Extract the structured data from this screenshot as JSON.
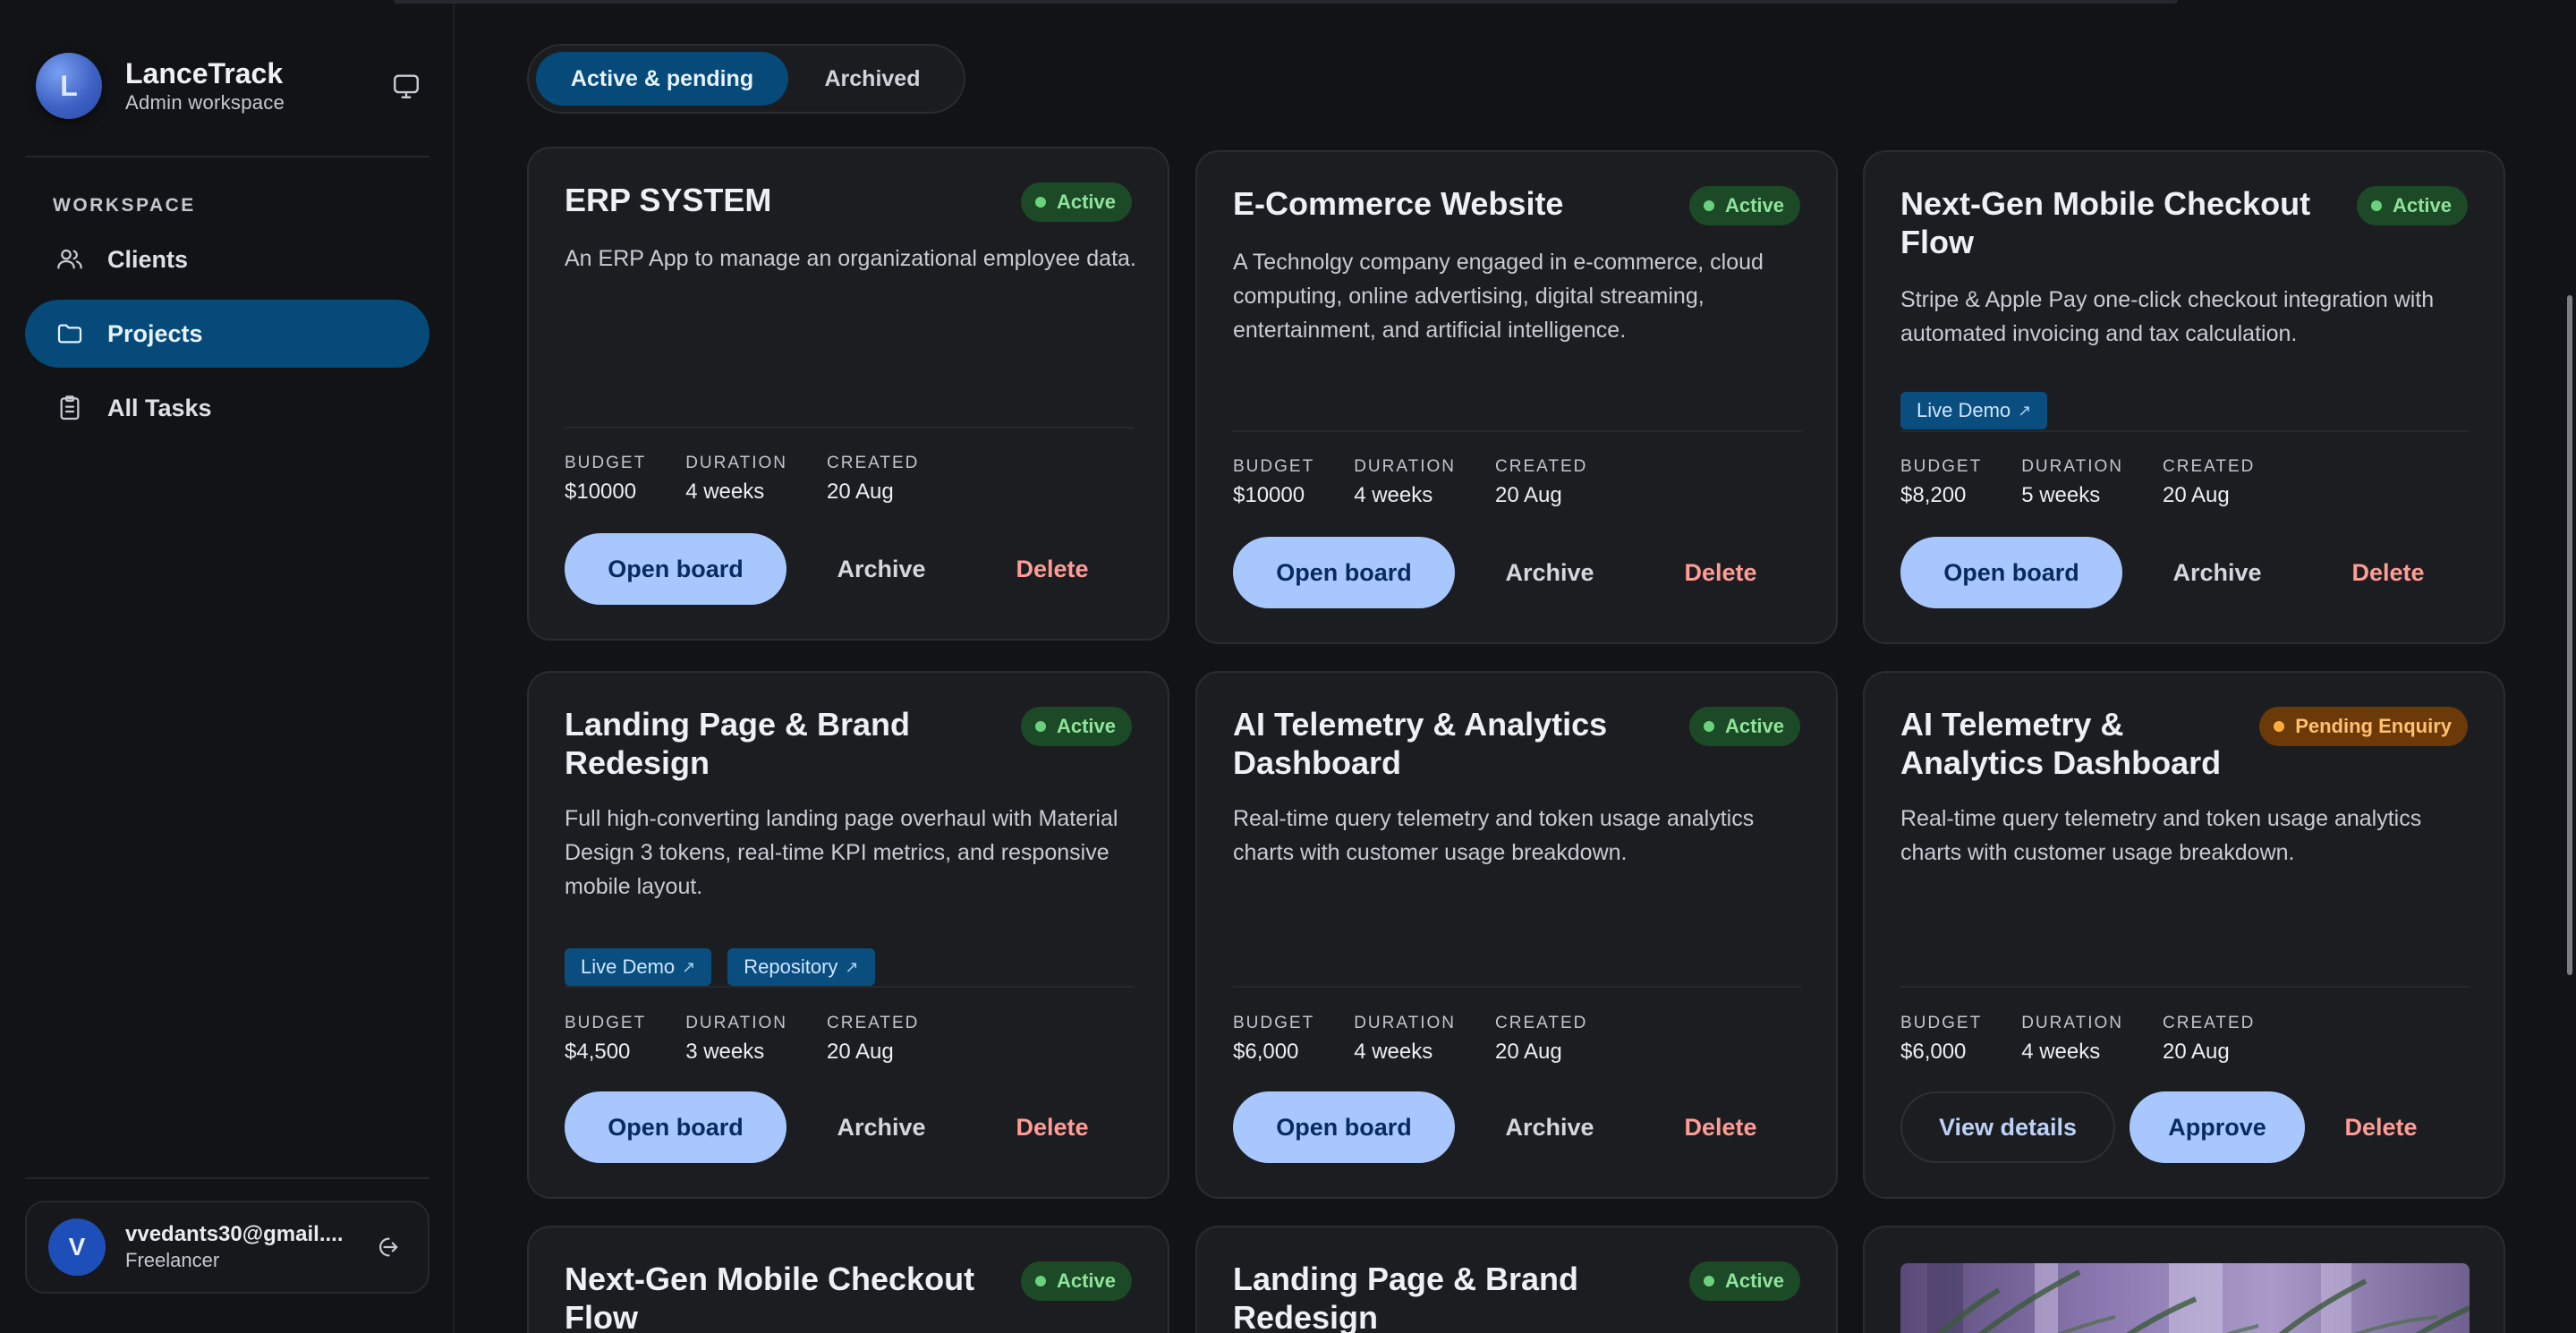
{
  "sidebar": {
    "brand": {
      "initial": "L",
      "name": "LanceTrack",
      "subtitle": "Admin workspace",
      "toggle_icon": "monitor-icon"
    },
    "section_title": "WORKSPACE",
    "items": [
      {
        "label": "Clients",
        "icon": "users-icon",
        "active": false
      },
      {
        "label": "Projects",
        "icon": "folder-icon",
        "active": true
      },
      {
        "label": "All Tasks",
        "icon": "clipboard-icon",
        "active": false
      }
    ],
    "user": {
      "initial": "V",
      "email": "vvedants30@gmail....",
      "role": "Freelancer",
      "logout_icon": "logout-icon"
    }
  },
  "tabs": [
    {
      "label": "Active & pending",
      "active": true
    },
    {
      "label": "Archived",
      "active": false
    }
  ],
  "meta_labels": {
    "budget": "BUDGET",
    "duration": "DURATION",
    "created": "CREATED"
  },
  "actions": {
    "open_board": "Open board",
    "archive": "Archive",
    "delete": "Delete",
    "view_details": "View details",
    "approve": "Approve"
  },
  "colors": {
    "accent": "#054a78",
    "primary_button": "#a9c7ff",
    "active_badge": "#1d4a26",
    "pending_badge": "#6b3a08",
    "delete_text": "#ff9c95"
  },
  "projects": [
    {
      "title": "ERP SYSTEM",
      "status": "Active",
      "description": "An ERP App to manage an organizational employee data.",
      "links": [],
      "budget": "$10000",
      "duration": "4 weeks",
      "created": "20 Aug"
    },
    {
      "title": "E-Commerce Website",
      "status": "Active",
      "description": "A Technolgy company engaged in e-commerce, cloud computing, online advertising, digital streaming, entertainment, and artificial intelligence.",
      "links": [],
      "budget": "$10000",
      "duration": "4 weeks",
      "created": "20 Aug"
    },
    {
      "title": "Next-Gen Mobile Checkout Flow",
      "status": "Active",
      "description": "Stripe & Apple Pay one-click checkout integration with automated invoicing and tax calculation.",
      "links": [
        "Live Demo"
      ],
      "budget": "$8,200",
      "duration": "5 weeks",
      "created": "20 Aug"
    },
    {
      "title": "Landing Page & Brand Redesign",
      "status": "Active",
      "description": "Full high-converting landing page overhaul with Material Design 3 tokens, real-time KPI metrics, and responsive mobile layout.",
      "links": [
        "Live Demo",
        "Repository"
      ],
      "budget": "$4,500",
      "duration": "3 weeks",
      "created": "20 Aug"
    },
    {
      "title": "AI Telemetry & Analytics Dashboard",
      "status": "Active",
      "description": "Real-time query telemetry and token usage analytics charts with customer usage breakdown.",
      "links": [],
      "budget": "$6,000",
      "duration": "4 weeks",
      "created": "20 Aug"
    },
    {
      "title": "AI Telemetry & Analytics Dashboard",
      "status": "Pending Enquiry",
      "description": "Real-time query telemetry and token usage analytics charts with customer usage breakdown.",
      "links": [],
      "budget": "$6,000",
      "duration": "4 weeks",
      "created": "20 Aug"
    },
    {
      "title": "Next-Gen Mobile Checkout Flow",
      "status": "Active"
    },
    {
      "title": "Landing Page & Brand Redesign",
      "status": "Active"
    }
  ]
}
